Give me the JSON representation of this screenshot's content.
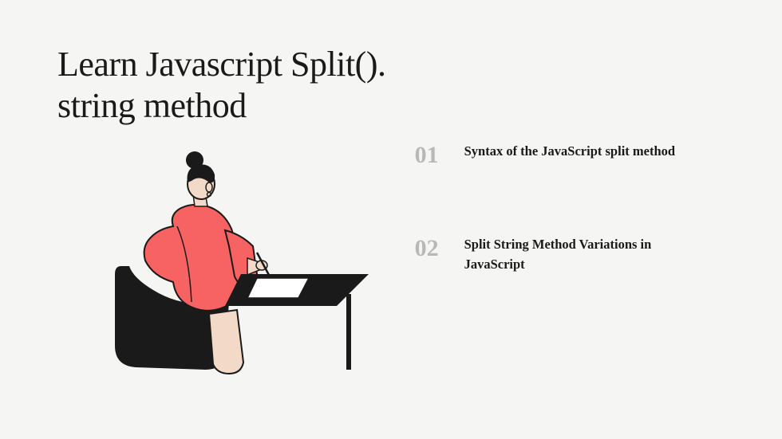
{
  "title": "Learn Javascript Split(). string method",
  "toc": [
    {
      "num": "01",
      "text": "Syntax of the JavaScript split method"
    },
    {
      "num": "02",
      "text": "Split String Method Variations in JavaScript"
    }
  ],
  "colors": {
    "accent": "#f76262",
    "dark": "#1a1a1a",
    "muted": "#b8b8b8",
    "bg": "#f5f5f4"
  }
}
